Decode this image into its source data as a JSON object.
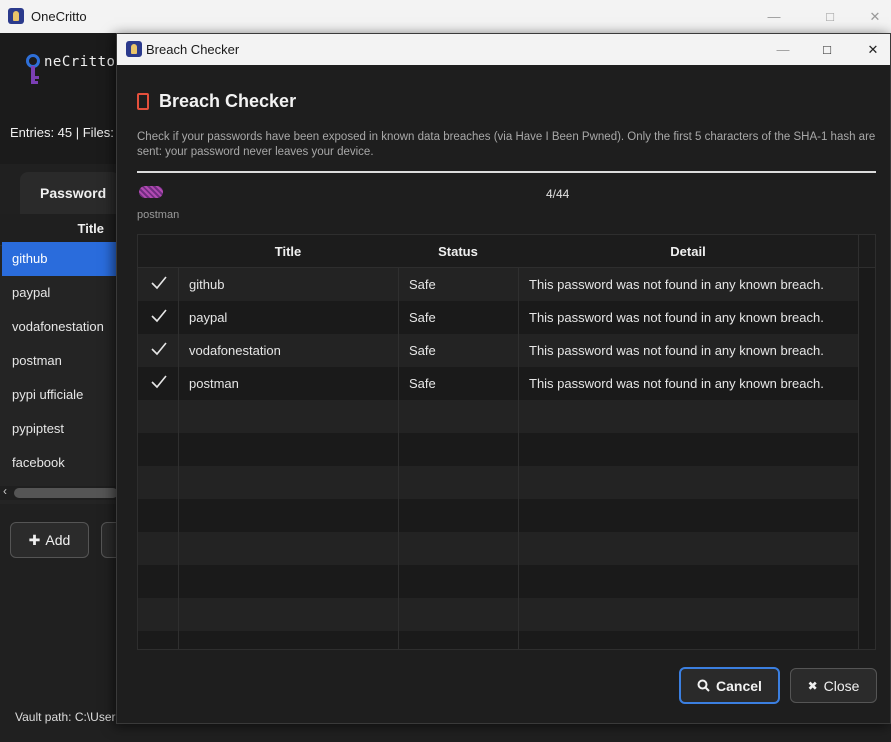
{
  "main_window": {
    "title": "OneCritto",
    "brand": "neCritto",
    "entries_line": "Entries: 45 | Files:",
    "tab_password": "Password",
    "entries_column_title": "Title",
    "entries": [
      "github",
      "paypal",
      "vodafonestation",
      "postman",
      "pypi ufficiale",
      "pypiptest",
      "facebook"
    ],
    "add_label": "Add",
    "vault_path": "Vault path: C:\\Users"
  },
  "dialog": {
    "window_title": "Breach Checker",
    "heading": "Breach Checker",
    "description": "Check if your passwords have been exposed in known data breaches (via Have I Been Pwned). Only the first 5 characters of the SHA-1 hash are sent: your password never leaves your device.",
    "current_entry": "postman",
    "progress": "4/44",
    "columns": {
      "title": "Title",
      "status": "Status",
      "detail": "Detail"
    },
    "results": [
      {
        "title": "github",
        "status": "Safe",
        "detail": "This password was not found in any known breach."
      },
      {
        "title": "paypal",
        "status": "Safe",
        "detail": "This password was not found in any known breach."
      },
      {
        "title": "vodafonestation",
        "status": "Safe",
        "detail": "This password was not found in any known breach."
      },
      {
        "title": "postman",
        "status": "Safe",
        "detail": "This password was not found in any known breach."
      }
    ],
    "cancel_label": "Cancel",
    "close_label": "Close"
  },
  "colors": {
    "accent": "#3b7fe0",
    "selection": "#2a6cdc",
    "heading_icon": "#e4503c",
    "logo_key": "#2e6fd8"
  }
}
